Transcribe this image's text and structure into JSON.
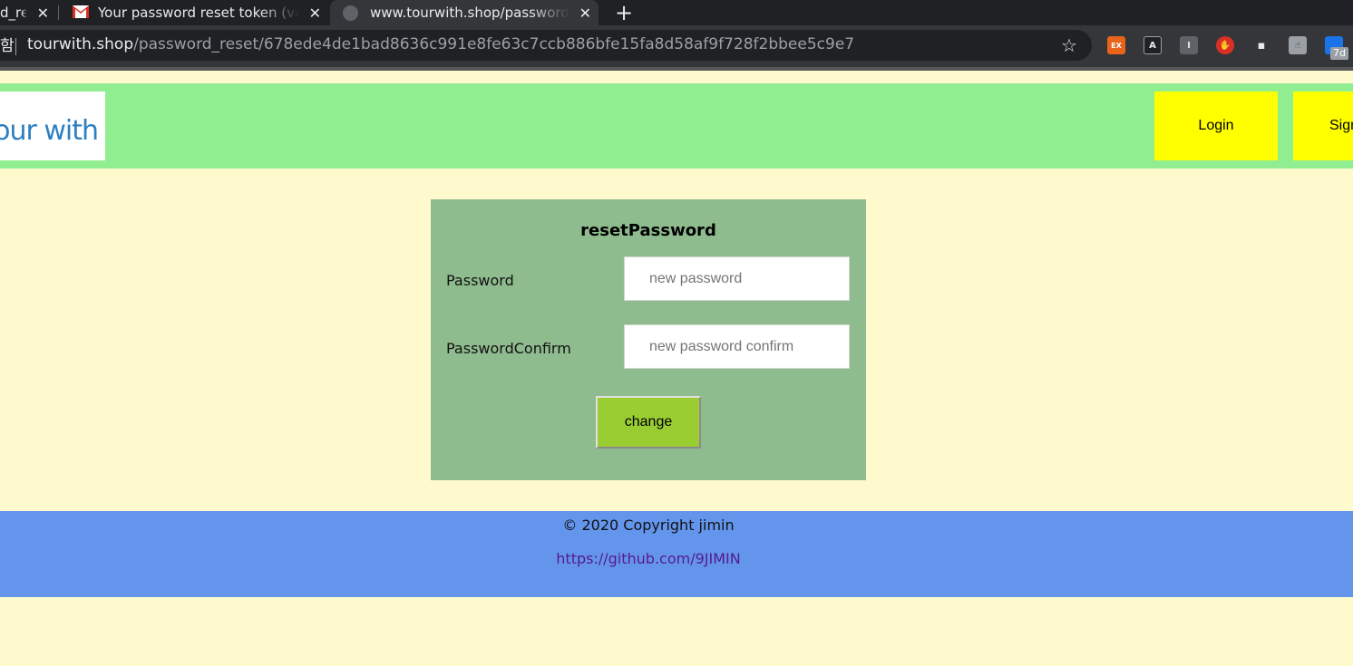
{
  "browser": {
    "tabs": [
      {
        "title": "d_re",
        "close": "✕"
      },
      {
        "title": "Your password reset token (valid",
        "close": "✕"
      },
      {
        "title": "www.tourwith.shop/password_reset",
        "close": "✕"
      }
    ],
    "new_tab": "+",
    "address": {
      "security_text": "함",
      "host": "tourwith.shop",
      "path": "/password_reset/678ede4de1bad8636c991e8fe63c7ccb886bfe15fa8d58af9f728f2bbee5c9e7"
    },
    "star": "☆",
    "extensions": [
      {
        "label": "EX",
        "icon": "ex-extension-icon"
      },
      {
        "label": "A",
        "icon": "a-extension-icon"
      },
      {
        "label": "I",
        "icon": "i-extension-icon"
      },
      {
        "label": "✋",
        "icon": "hand-stop-icon"
      },
      {
        "label": "▪",
        "icon": "screen-extension-icon"
      },
      {
        "label": "☝",
        "icon": "pointer-extension-icon"
      },
      {
        "label": "",
        "icon": "calendar-extension-icon"
      }
    ],
    "extension_badge": "7d"
  },
  "header": {
    "logo_text": "our with",
    "login_label": "Login",
    "signup_label": "Sign"
  },
  "reset_form": {
    "title": "resetPassword",
    "password_label": "Password",
    "password_placeholder": "new password",
    "password_value": "",
    "confirm_label": "PasswordConfirm",
    "confirm_placeholder": "new password confirm",
    "confirm_value": "",
    "submit_label": "change"
  },
  "footer": {
    "copyright": "© 2020 Copyright jimin",
    "github_link": "https://github.com/9JIMIN"
  },
  "colors": {
    "page_bg": "#fffacd",
    "header_bg": "#90ee90",
    "nav_button_bg": "#ffff00",
    "card_bg": "#8fbc8f",
    "submit_bg": "#9acd32",
    "footer_bg": "#6495ed",
    "link": "#551a8b"
  }
}
